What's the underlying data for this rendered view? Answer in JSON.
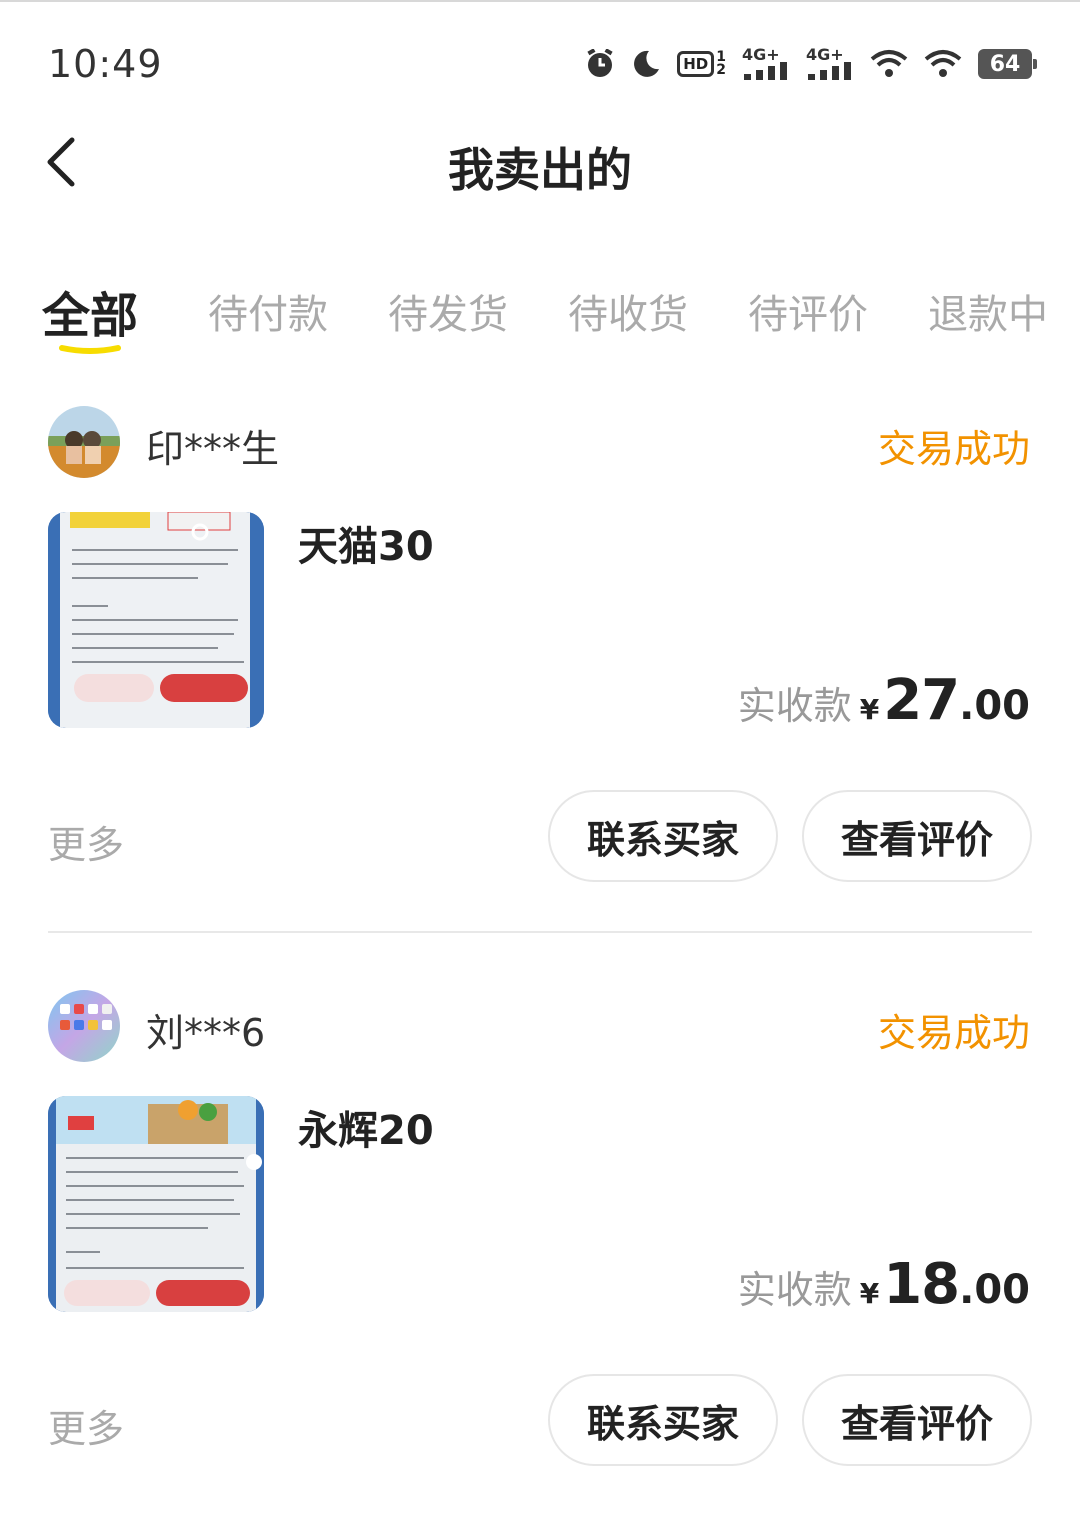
{
  "status_bar": {
    "time": "10:49",
    "icons": [
      "alarm-icon",
      "moon-icon",
      "hd-icon",
      "signal-4g-icon",
      "signal-4g-icon",
      "wifi-icon",
      "wifi-icon",
      "battery-icon"
    ],
    "hd_label": "HD",
    "net1_label": "4G+",
    "net2_label": "4G+",
    "battery_level": "64"
  },
  "header": {
    "title": "我卖出的"
  },
  "tabs": [
    {
      "label": "全部",
      "active": true
    },
    {
      "label": "待付款",
      "active": false
    },
    {
      "label": "待发货",
      "active": false
    },
    {
      "label": "待收货",
      "active": false
    },
    {
      "label": "待评价",
      "active": false
    },
    {
      "label": "退款中",
      "active": false
    }
  ],
  "accent_color": "#f7dc00",
  "status_color": "#f29200",
  "orders": [
    {
      "buyer": "印***生",
      "status": "交易成功",
      "product_title": "天猫30",
      "price_label": "实收款",
      "currency": "¥",
      "price_int": "27",
      "price_dec": ".00",
      "more": "更多",
      "btn_contact": "联系买家",
      "btn_review": "查看评价"
    },
    {
      "buyer": "刘***6",
      "status": "交易成功",
      "product_title": "永辉20",
      "price_label": "实收款",
      "currency": "¥",
      "price_int": "18",
      "price_dec": ".00",
      "more": "更多",
      "btn_contact": "联系买家",
      "btn_review": "查看评价"
    }
  ]
}
